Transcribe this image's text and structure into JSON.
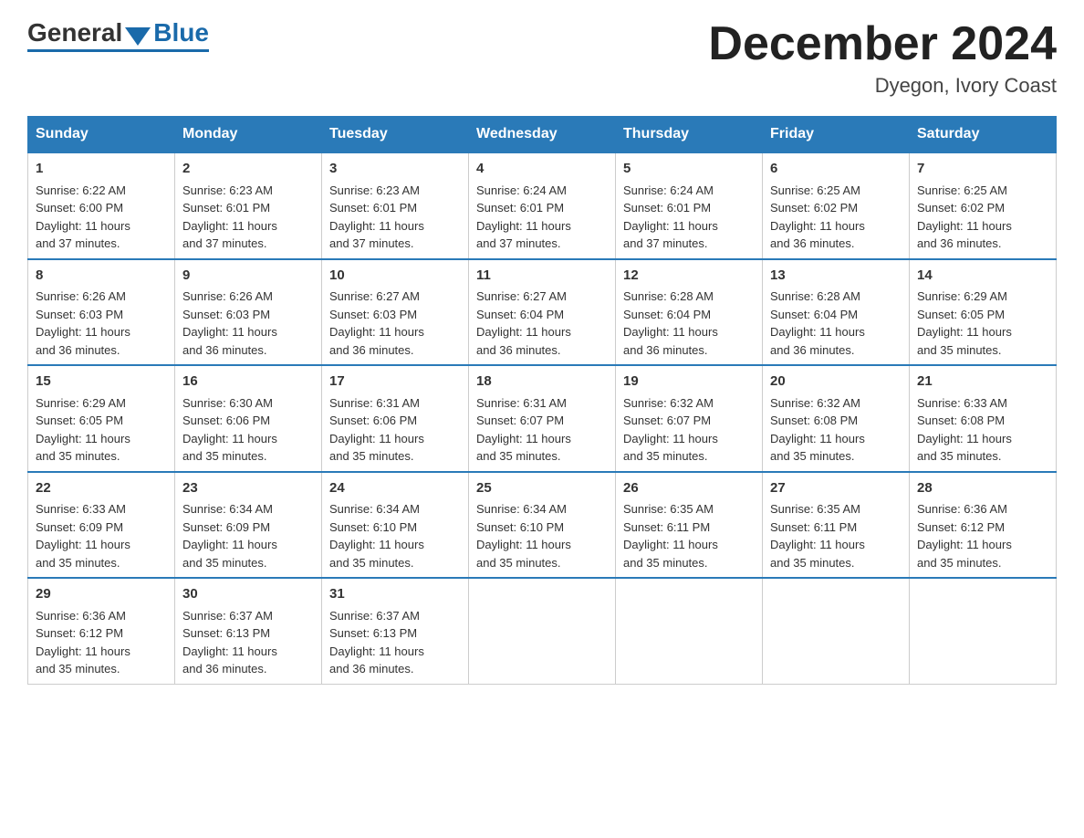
{
  "logo": {
    "general": "General",
    "blue": "Blue"
  },
  "title": "December 2024",
  "location": "Dyegon, Ivory Coast",
  "days_header": [
    "Sunday",
    "Monday",
    "Tuesday",
    "Wednesday",
    "Thursday",
    "Friday",
    "Saturday"
  ],
  "weeks": [
    [
      {
        "day": "1",
        "sunrise": "6:22 AM",
        "sunset": "6:00 PM",
        "daylight": "11 hours and 37 minutes."
      },
      {
        "day": "2",
        "sunrise": "6:23 AM",
        "sunset": "6:01 PM",
        "daylight": "11 hours and 37 minutes."
      },
      {
        "day": "3",
        "sunrise": "6:23 AM",
        "sunset": "6:01 PM",
        "daylight": "11 hours and 37 minutes."
      },
      {
        "day": "4",
        "sunrise": "6:24 AM",
        "sunset": "6:01 PM",
        "daylight": "11 hours and 37 minutes."
      },
      {
        "day": "5",
        "sunrise": "6:24 AM",
        "sunset": "6:01 PM",
        "daylight": "11 hours and 37 minutes."
      },
      {
        "day": "6",
        "sunrise": "6:25 AM",
        "sunset": "6:02 PM",
        "daylight": "11 hours and 36 minutes."
      },
      {
        "day": "7",
        "sunrise": "6:25 AM",
        "sunset": "6:02 PM",
        "daylight": "11 hours and 36 minutes."
      }
    ],
    [
      {
        "day": "8",
        "sunrise": "6:26 AM",
        "sunset": "6:03 PM",
        "daylight": "11 hours and 36 minutes."
      },
      {
        "day": "9",
        "sunrise": "6:26 AM",
        "sunset": "6:03 PM",
        "daylight": "11 hours and 36 minutes."
      },
      {
        "day": "10",
        "sunrise": "6:27 AM",
        "sunset": "6:03 PM",
        "daylight": "11 hours and 36 minutes."
      },
      {
        "day": "11",
        "sunrise": "6:27 AM",
        "sunset": "6:04 PM",
        "daylight": "11 hours and 36 minutes."
      },
      {
        "day": "12",
        "sunrise": "6:28 AM",
        "sunset": "6:04 PM",
        "daylight": "11 hours and 36 minutes."
      },
      {
        "day": "13",
        "sunrise": "6:28 AM",
        "sunset": "6:04 PM",
        "daylight": "11 hours and 36 minutes."
      },
      {
        "day": "14",
        "sunrise": "6:29 AM",
        "sunset": "6:05 PM",
        "daylight": "11 hours and 35 minutes."
      }
    ],
    [
      {
        "day": "15",
        "sunrise": "6:29 AM",
        "sunset": "6:05 PM",
        "daylight": "11 hours and 35 minutes."
      },
      {
        "day": "16",
        "sunrise": "6:30 AM",
        "sunset": "6:06 PM",
        "daylight": "11 hours and 35 minutes."
      },
      {
        "day": "17",
        "sunrise": "6:31 AM",
        "sunset": "6:06 PM",
        "daylight": "11 hours and 35 minutes."
      },
      {
        "day": "18",
        "sunrise": "6:31 AM",
        "sunset": "6:07 PM",
        "daylight": "11 hours and 35 minutes."
      },
      {
        "day": "19",
        "sunrise": "6:32 AM",
        "sunset": "6:07 PM",
        "daylight": "11 hours and 35 minutes."
      },
      {
        "day": "20",
        "sunrise": "6:32 AM",
        "sunset": "6:08 PM",
        "daylight": "11 hours and 35 minutes."
      },
      {
        "day": "21",
        "sunrise": "6:33 AM",
        "sunset": "6:08 PM",
        "daylight": "11 hours and 35 minutes."
      }
    ],
    [
      {
        "day": "22",
        "sunrise": "6:33 AM",
        "sunset": "6:09 PM",
        "daylight": "11 hours and 35 minutes."
      },
      {
        "day": "23",
        "sunrise": "6:34 AM",
        "sunset": "6:09 PM",
        "daylight": "11 hours and 35 minutes."
      },
      {
        "day": "24",
        "sunrise": "6:34 AM",
        "sunset": "6:10 PM",
        "daylight": "11 hours and 35 minutes."
      },
      {
        "day": "25",
        "sunrise": "6:34 AM",
        "sunset": "6:10 PM",
        "daylight": "11 hours and 35 minutes."
      },
      {
        "day": "26",
        "sunrise": "6:35 AM",
        "sunset": "6:11 PM",
        "daylight": "11 hours and 35 minutes."
      },
      {
        "day": "27",
        "sunrise": "6:35 AM",
        "sunset": "6:11 PM",
        "daylight": "11 hours and 35 minutes."
      },
      {
        "day": "28",
        "sunrise": "6:36 AM",
        "sunset": "6:12 PM",
        "daylight": "11 hours and 35 minutes."
      }
    ],
    [
      {
        "day": "29",
        "sunrise": "6:36 AM",
        "sunset": "6:12 PM",
        "daylight": "11 hours and 35 minutes."
      },
      {
        "day": "30",
        "sunrise": "6:37 AM",
        "sunset": "6:13 PM",
        "daylight": "11 hours and 36 minutes."
      },
      {
        "day": "31",
        "sunrise": "6:37 AM",
        "sunset": "6:13 PM",
        "daylight": "11 hours and 36 minutes."
      },
      null,
      null,
      null,
      null
    ]
  ],
  "labels": {
    "sunrise": "Sunrise:",
    "sunset": "Sunset:",
    "daylight": "Daylight:"
  }
}
